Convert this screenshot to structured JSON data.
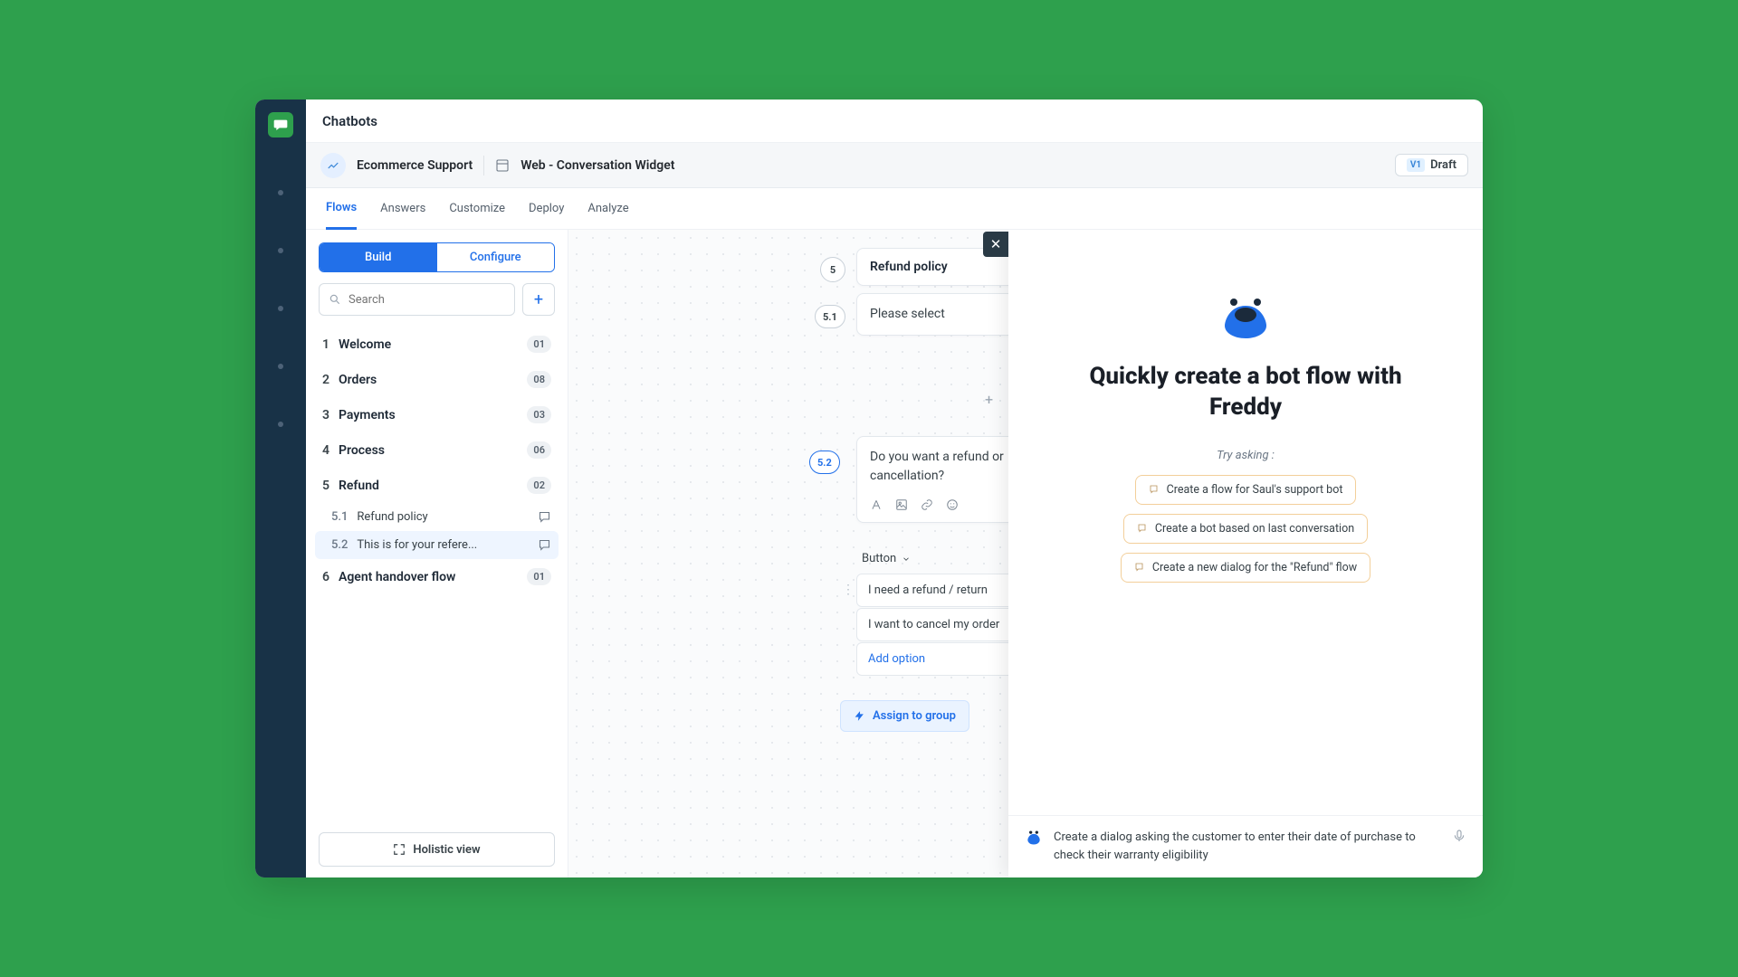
{
  "header": {
    "title": "Chatbots"
  },
  "breadcrumb": {
    "project": "Ecommerce Support",
    "widget": "Web - Conversation Widget",
    "version_tag": "V1",
    "status": "Draft"
  },
  "tabs": [
    "Flows",
    "Answers",
    "Customize",
    "Deploy",
    "Analyze"
  ],
  "active_tab": "Flows",
  "segmented": {
    "build": "Build",
    "configure": "Configure",
    "active": "Build"
  },
  "search": {
    "placeholder": "Search"
  },
  "flows": [
    {
      "num": "1",
      "label": "Welcome",
      "count": "01"
    },
    {
      "num": "2",
      "label": "Orders",
      "count": "08"
    },
    {
      "num": "3",
      "label": "Payments",
      "count": "03"
    },
    {
      "num": "4",
      "label": "Process",
      "count": "06"
    },
    {
      "num": "5",
      "label": "Refund",
      "count": "02",
      "children": [
        {
          "num": "5.1",
          "label": "Refund policy"
        },
        {
          "num": "5.2",
          "label": "This is for your refere...",
          "active": true
        }
      ]
    },
    {
      "num": "6",
      "label": "Agent handover flow",
      "count": "01"
    }
  ],
  "holistic_label": "Holistic view",
  "canvas": {
    "root_num": "5",
    "root_title": "Refund policy",
    "node51_num": "5.1",
    "node51_text": "Please select",
    "node52_num": "5.2",
    "node52_text": "Do you want a refund or cancellation?",
    "button_label": "Button",
    "option1": "I need a refund / return",
    "option2": "I want to cancel my order",
    "add_option": "Add option",
    "assign_label": "Assign to group"
  },
  "freddy": {
    "title": "Quickly create a bot flow with Freddy",
    "try_label": "Try asking :",
    "suggestions": [
      "Create a flow for Saul's support bot",
      "Create a bot based on last conversation",
      "Create a new dialog for the \"Refund\" flow"
    ],
    "input_text": "Create a dialog asking the customer to enter their date of purchase to check their warranty eligibility"
  }
}
